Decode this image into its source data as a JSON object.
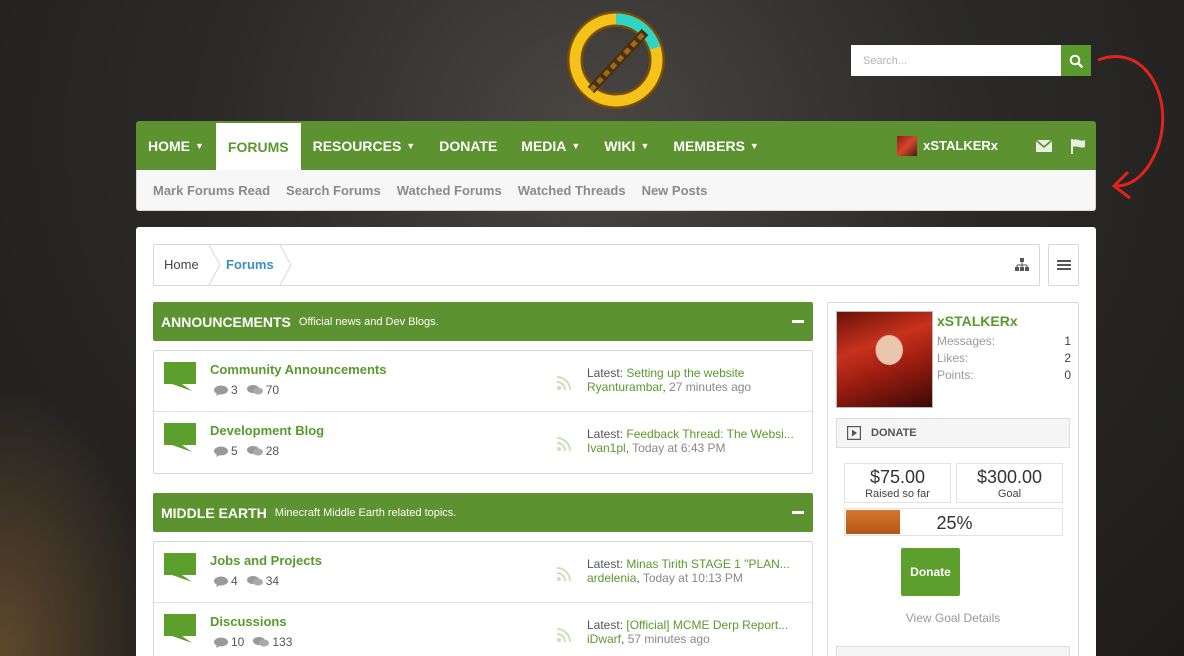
{
  "search": {
    "placeholder": "Search..."
  },
  "nav": {
    "items": [
      {
        "label": "HOME",
        "dropdown": true
      },
      {
        "label": "FORUMS",
        "dropdown": false,
        "active": true
      },
      {
        "label": "RESOURCES",
        "dropdown": true
      },
      {
        "label": "DONATE",
        "dropdown": false
      },
      {
        "label": "MEDIA",
        "dropdown": true
      },
      {
        "label": "WIKI",
        "dropdown": true
      },
      {
        "label": "MEMBERS",
        "dropdown": true
      }
    ],
    "username": "xSTALKERx",
    "icons": [
      "envelope-icon",
      "flag-icon"
    ]
  },
  "subnav": {
    "links": [
      "Mark Forums Read",
      "Search Forums",
      "Watched Forums",
      "Watched Threads",
      "New Posts"
    ]
  },
  "breadcrumb": {
    "home": "Home",
    "current": "Forums"
  },
  "categories": [
    {
      "title": "ANNOUNCEMENTS",
      "description": "Official news and Dev Blogs.",
      "forums": [
        {
          "name": "Community Announcements",
          "threads": "3",
          "messages": "70",
          "latest_label": "Latest:",
          "latest_title": "Setting up the website",
          "latest_user": "Ryanturambar",
          "latest_time": "27 minutes ago"
        },
        {
          "name": "Development Blog",
          "threads": "5",
          "messages": "28",
          "latest_label": "Latest:",
          "latest_title": "Feedback Thread: The Websi...",
          "latest_user": "Ivan1pl",
          "latest_time": "Today at 6:43 PM"
        }
      ]
    },
    {
      "title": "MIDDLE EARTH",
      "description": "Minecraft Middle Earth related topics.",
      "forums": [
        {
          "name": "Jobs and Projects",
          "threads": "4",
          "messages": "34",
          "latest_label": "Latest:",
          "latest_title": "Minas Tirith STAGE 1 \"PLAN...",
          "latest_user": "ardelenia",
          "latest_time": "Today at 10:13 PM"
        },
        {
          "name": "Discussions",
          "threads": "10",
          "messages": "133",
          "latest_label": "Latest:",
          "latest_title": "[Official] MCME Derp Report...",
          "latest_user": "iDwarf",
          "latest_time": "57 minutes ago"
        }
      ]
    }
  ],
  "sidebar": {
    "username": "xSTALKERx",
    "stats": [
      {
        "label": "Messages:",
        "value": "1"
      },
      {
        "label": "Likes:",
        "value": "2"
      },
      {
        "label": "Points:",
        "value": "0"
      }
    ],
    "donate_heading": "DONATE",
    "raised": "$75.00",
    "raised_label": "Raised so far",
    "goal": "$300.00",
    "goal_label": "Goal",
    "progress_percent": 25,
    "progress_text": "25%",
    "donate_button": "Donate",
    "goal_details": "View Goal Details"
  },
  "colors": {
    "brand_green": "#5c922f",
    "link_green": "#5a9a2c",
    "progress_orange": "#c8621f",
    "crumb_blue": "#3b8fc2"
  }
}
